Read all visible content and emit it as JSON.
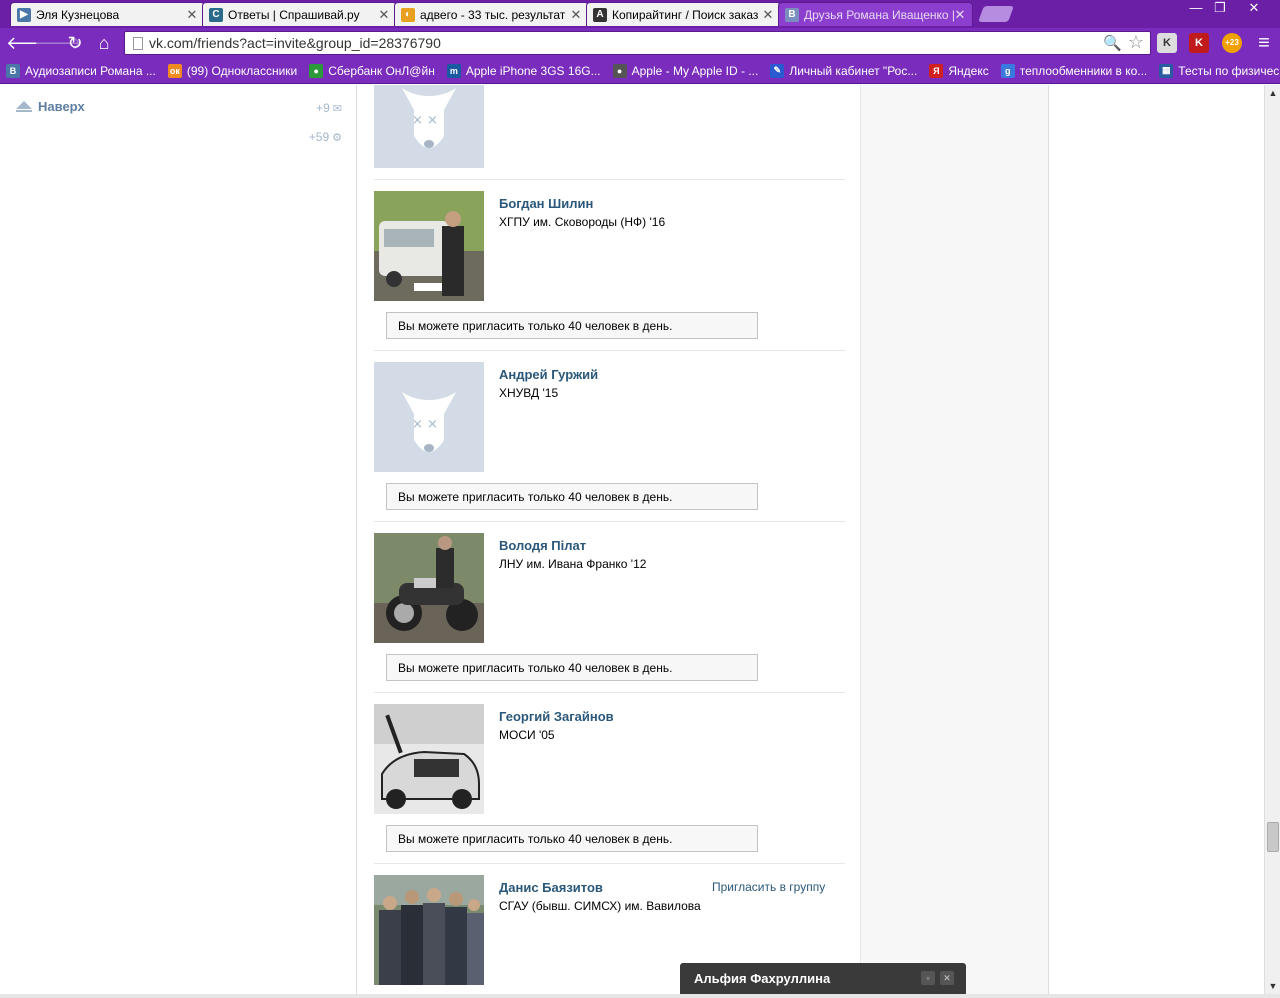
{
  "browser": {
    "tabs": [
      {
        "title": "Эля Кузнецова",
        "favicon_color": "#4a76a8",
        "favicon_text": "▶",
        "active": false
      },
      {
        "title": "Ответы | Спрашивай.ру",
        "favicon_color": "#2a6a8a",
        "favicon_text": "C",
        "active": false
      },
      {
        "title": "адвего - 33 тыс. результат",
        "favicon_color": "#e8a020",
        "favicon_text": "◐",
        "active": false
      },
      {
        "title": "Копирайтинг / Поиск заказ",
        "favicon_color": "#333333",
        "favicon_text": "A",
        "active": false
      },
      {
        "title": "Друзья Романа Иващенко |",
        "favicon_color": "#7a8fc0",
        "favicon_text": "B",
        "active": true
      }
    ],
    "url": "vk.com/friends?act=invite&group_id=28376790",
    "bookmarks": [
      {
        "label": "Аудиозаписи Романа ...",
        "icon_color": "#4a76a8",
        "icon_text": "B"
      },
      {
        "label": "(99) Одноклассники",
        "icon_color": "#f28a1e",
        "icon_text": "ок"
      },
      {
        "label": "Сбербанк ОнЛ@йн",
        "icon_color": "#2a9a3a",
        "icon_text": "●"
      },
      {
        "label": "Apple iPhone 3GS 16G...",
        "icon_color": "#1a5aa0",
        "icon_text": "m"
      },
      {
        "label": "Apple - My Apple ID - ...",
        "icon_color": "#555555",
        "icon_text": "●"
      },
      {
        "label": "Личный кабинет \"Рос...",
        "icon_color": "#2a5ad0",
        "icon_text": "✎"
      },
      {
        "label": "Яндекс",
        "icon_color": "#d02020",
        "icon_text": "Я"
      },
      {
        "label": "теплообменники в ко...",
        "icon_color": "#3a7ae0",
        "icon_text": "g"
      },
      {
        "label": "Тесты по физическо...",
        "icon_color": "#2a5aa0",
        "icon_text": "▦"
      }
    ],
    "extensions": [
      {
        "name": "k-icon",
        "text": "K",
        "bg": "#dddddd",
        "color": "#333333"
      },
      {
        "name": "kaspersky-icon",
        "text": "K",
        "bg": "#c01a1a",
        "color": "#ffffff"
      },
      {
        "name": "weather-icon",
        "text": "+23",
        "bg": "#f0a000",
        "color": "#ffffff"
      }
    ],
    "window_controls": [
      "—",
      "❐",
      "✕"
    ],
    "menu_icon": "≡"
  },
  "sidebar": {
    "up_label": "Наверх",
    "messages_count": "+9",
    "notifications_count": "+59"
  },
  "friends": [
    {
      "name": "",
      "subtitle": "",
      "avatar": "placeholder",
      "has_limit": false,
      "invite_label": ""
    },
    {
      "name": "Богдан Шилин",
      "subtitle": "ХГПУ им. Сковороды (НФ) '16",
      "avatar": "car",
      "has_limit": true,
      "invite_label": ""
    },
    {
      "name": "Андрей Гуржий",
      "subtitle": "ХНУВД '15",
      "avatar": "placeholder",
      "has_limit": true,
      "invite_label": ""
    },
    {
      "name": "Володя Пілат",
      "subtitle": "ЛНУ им. Ивана Франко '12",
      "avatar": "motorcycle",
      "has_limit": true,
      "invite_label": ""
    },
    {
      "name": "Георгий Загайнов",
      "subtitle": "МОСИ '05",
      "avatar": "bw-car",
      "has_limit": true,
      "invite_label": ""
    },
    {
      "name": "Данис Баязитов",
      "subtitle": "СГАУ (бывш. СИМСХ) им. Вавилова",
      "avatar": "group",
      "has_limit": false,
      "invite_label": "Пригласить в группу"
    }
  ],
  "limit_message": "Вы можете пригласить только 40 человек в день.",
  "chat": {
    "name": "Альфия Фахруллина"
  }
}
